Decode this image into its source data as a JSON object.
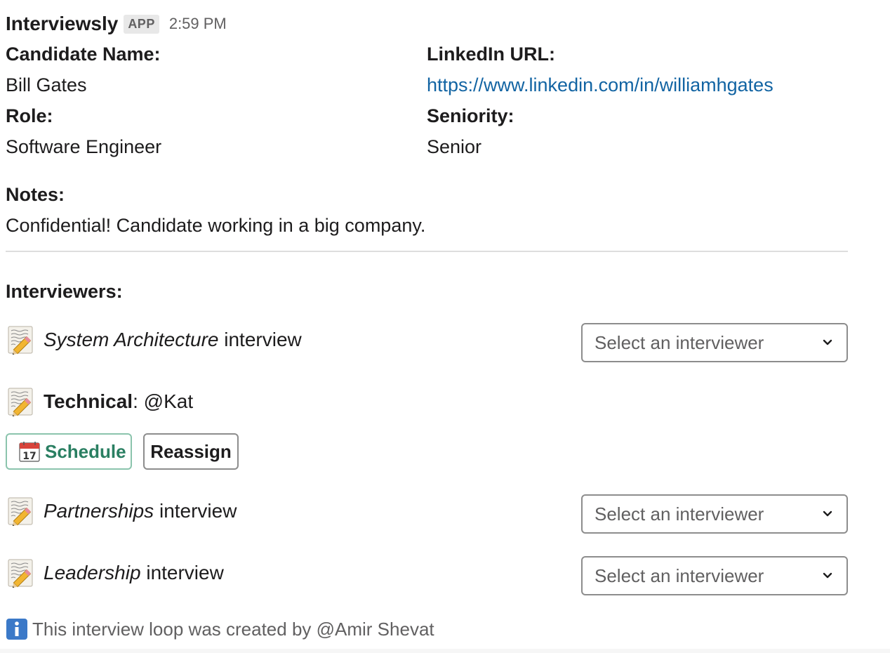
{
  "message": {
    "app_name": "Interviewsly",
    "badge": "APP",
    "timestamp": "2:59 PM"
  },
  "candidate": {
    "name_label": "Candidate Name:",
    "name_value": "Bill Gates",
    "linkedin_label": "LinkedIn URL:",
    "linkedin_value": "https://www.linkedin.com/in/williamhgates",
    "role_label": "Role:",
    "role_value": "Software Engineer",
    "seniority_label": "Seniority:",
    "seniority_value": "Senior",
    "notes_label": "Notes:",
    "notes_value": "Confidential! Candidate working in a big company."
  },
  "interviewers": {
    "heading": "Interviewers:",
    "rows": [
      {
        "topic": "System Architecture",
        "suffix": " interview",
        "select_placeholder": "Select an interviewer"
      },
      {
        "topic": "Technical",
        "assignee": ": @Kat",
        "schedule_label": "Schedule",
        "reassign_label": "Reassign"
      },
      {
        "topic": "Partnerships",
        "suffix": " interview",
        "select_placeholder": "Select an interviewer"
      },
      {
        "topic": "Leadership",
        "suffix": " interview",
        "select_placeholder": "Select an interviewer"
      }
    ]
  },
  "footer": {
    "text": "This interview loop was created by @Amir Shevat"
  },
  "icons": {
    "row_icon": "memo-icon",
    "schedule_icon": "calendar-icon",
    "footer_icon": "info-icon",
    "select_icon": "chevron-down-icon"
  },
  "colors": {
    "link": "#1264a3",
    "schedule_accent": "#2a7f62",
    "muted_text": "#616061"
  }
}
